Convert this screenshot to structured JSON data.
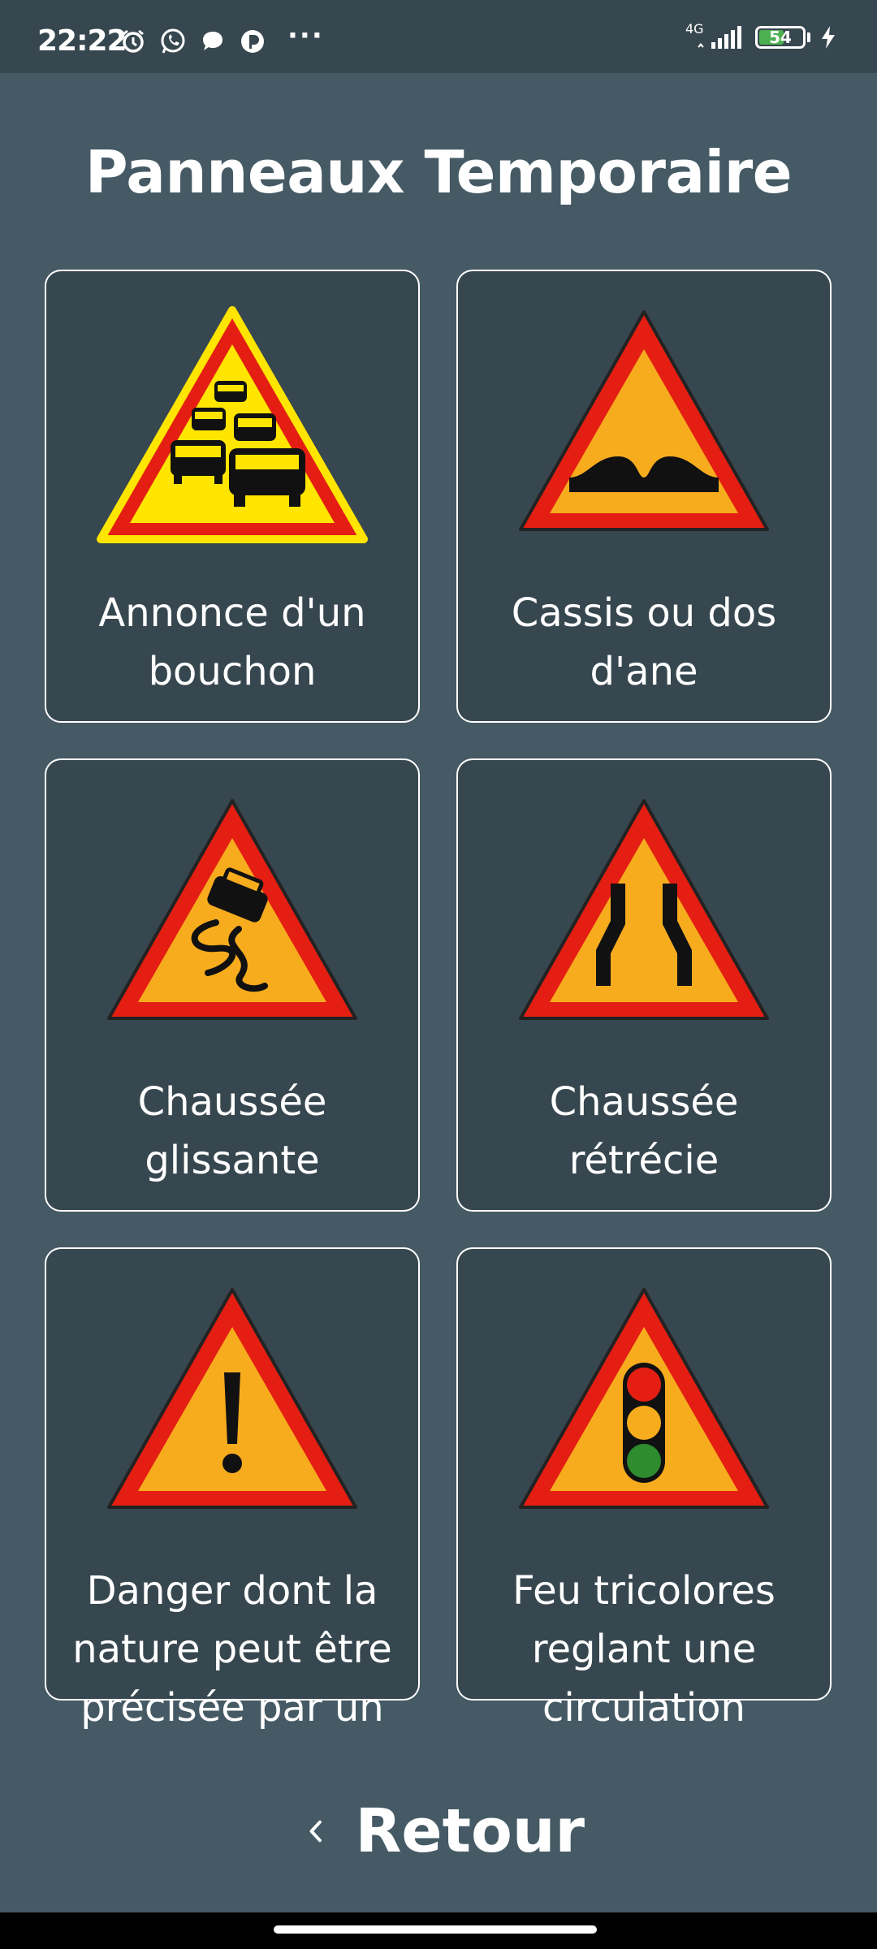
{
  "status_bar": {
    "time": "22:22",
    "network": "4G",
    "battery": "54",
    "icons": [
      "alarm-icon",
      "whatsapp-icon",
      "message-icon",
      "app-icon",
      "more-dots-icon",
      "signal-icon",
      "battery-icon",
      "charging-icon"
    ],
    "more": "···"
  },
  "page": {
    "title": "Panneaux Temporaire"
  },
  "signs": [
    {
      "label": "Annonce d'un bouchon",
      "icon": "traffic-jam-sign-icon"
    },
    {
      "label": "Cassis ou dos d'ane",
      "icon": "speed-bump-sign-icon"
    },
    {
      "label": "Chaussée glissante",
      "icon": "slippery-road-sign-icon"
    },
    {
      "label": "Chaussée rétrécie",
      "icon": "road-narrows-sign-icon"
    },
    {
      "label": "Danger dont la nature peut être précisée par un",
      "icon": "general-danger-sign-icon"
    },
    {
      "label": "Feu tricolores reglant une circulation",
      "icon": "traffic-light-sign-icon"
    }
  ],
  "footer": {
    "back_label": "Retour",
    "back_icon": "chevron-left-icon"
  },
  "colors": {
    "background": "#455a64",
    "card": "#37474f",
    "sign_red": "#e41e12",
    "sign_yellow": "#f7ac1e",
    "sign_bright_yellow": "#ffe500",
    "battery_green": "#4caf50"
  }
}
